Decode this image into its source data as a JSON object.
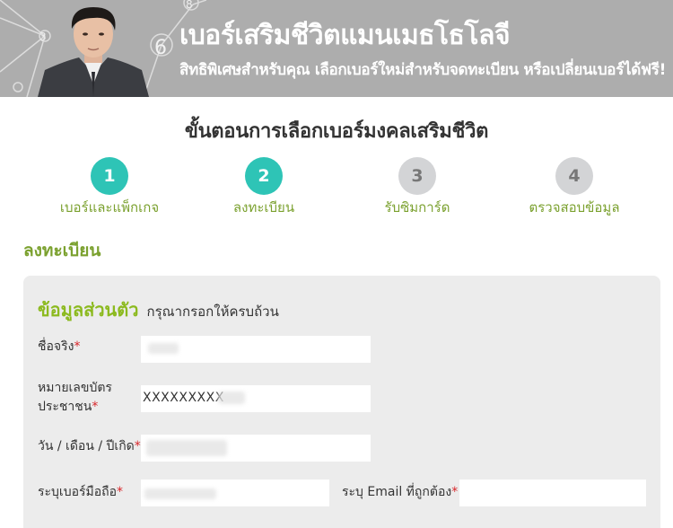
{
  "banner": {
    "title": "เบอร์เสริมชีวิตแมนเมธโธโลจี",
    "subtitle": "สิทธิพิเศษสำหรับคุณ เลือกเบอร์ใหม่สำหรับจดทะเบียน หรือเปลี่ยนเบอร์ได้ฟรี!",
    "graphic_numbers": [
      "3",
      "6",
      "8"
    ]
  },
  "steps": {
    "title": "ขั้นตอนการเลือกเบอร์มงคลเสริมชีวิต",
    "items": [
      {
        "number": "1",
        "label": "เบอร์และแพ็กเกจ",
        "status": "active"
      },
      {
        "number": "2",
        "label": "ลงทะเบียน",
        "status": "active"
      },
      {
        "number": "3",
        "label": "รับซิมการ์ด",
        "status": "inactive"
      },
      {
        "number": "4",
        "label": "ตรวจสอบข้อมูล",
        "status": "inactive"
      }
    ]
  },
  "section_title": "ลงทะเบียน",
  "form": {
    "heading": "ข้อมูลส่วนตัว",
    "subheading": "กรุณากรอกให้ครบถ้วน",
    "required_mark": "*",
    "fields": {
      "name": {
        "label": "ชื่อจริง",
        "value": ""
      },
      "id_card": {
        "label_line1": "หมายเลขบัตร",
        "label_line2": "ประชาชน",
        "value": "XXXXXXXXX"
      },
      "birthdate": {
        "label": "วัน / เดือน / ปีเกิด",
        "value": ""
      },
      "phone": {
        "label": "ระบุเบอร์มือถือ",
        "value": ""
      },
      "email": {
        "label": "ระบุ Email ที่ถูกต้อง",
        "value": ""
      }
    }
  },
  "colors": {
    "banner_bg": "#adadad",
    "step_active": "#2ec4b6",
    "step_inactive": "#d3d4d6",
    "accent_green": "#7ba12f",
    "heading_green": "#8cba1f",
    "required_red": "#d8262a",
    "card_bg": "#ececec"
  }
}
